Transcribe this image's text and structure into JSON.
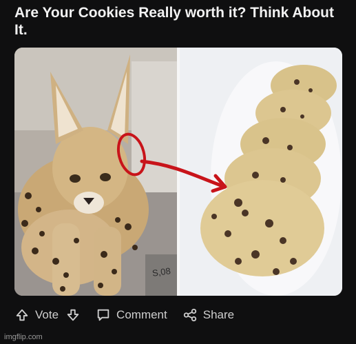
{
  "post": {
    "title": "Are Your Cookies Really worth it? Think About It."
  },
  "actions": {
    "vote_label": "Vote",
    "comment_label": "Comment",
    "share_label": "Share"
  },
  "image_texts": {
    "bag_text": "S,08"
  },
  "watermark": "imgflip.com",
  "colors": {
    "background": "#0f0f10",
    "annotation_red": "#c8141a",
    "text_primary": "#f2f2f2",
    "text_secondary": "#cfcfcf"
  },
  "icons": [
    "upvote-icon",
    "downvote-icon",
    "comment-icon",
    "share-icon"
  ]
}
